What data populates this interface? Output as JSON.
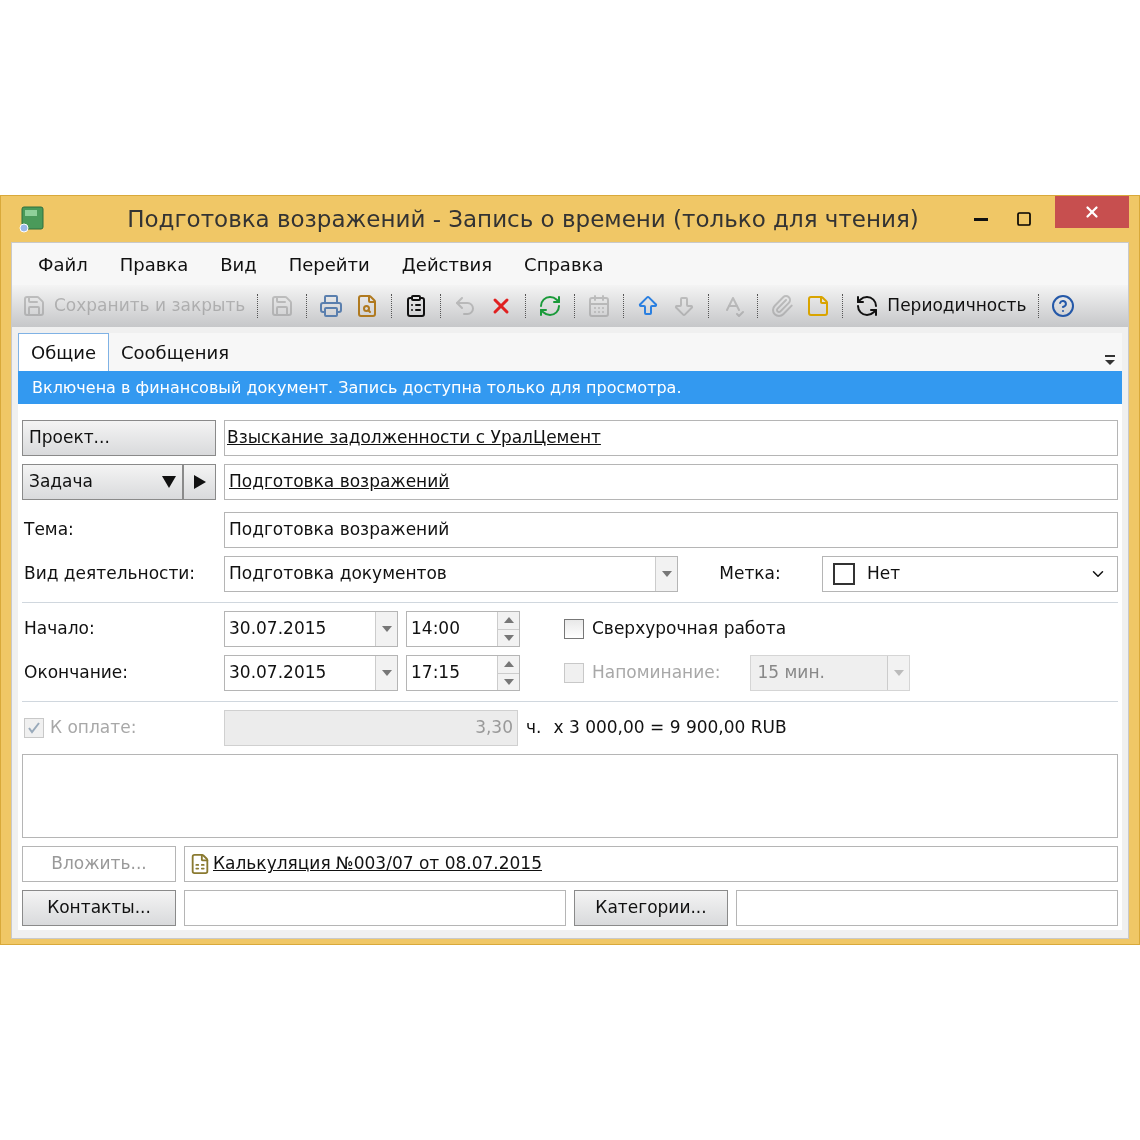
{
  "window": {
    "title": "Подготовка возражений - Запись о времени (только для чтения)"
  },
  "menu": [
    "Файл",
    "Правка",
    "Вид",
    "Перейти",
    "Действия",
    "Справка"
  ],
  "toolbar": [
    {
      "kind": "save-close",
      "label": "Сохранить и закрыть",
      "disabled": true
    },
    {
      "kind": "separator"
    },
    {
      "kind": "save",
      "disabled": true
    },
    {
      "kind": "separator"
    },
    {
      "kind": "print",
      "disabled": false
    },
    {
      "kind": "preview",
      "disabled": false
    },
    {
      "kind": "separator"
    },
    {
      "kind": "properties",
      "disabled": false
    },
    {
      "kind": "separator"
    },
    {
      "kind": "undo",
      "disabled": true
    },
    {
      "kind": "delete",
      "disabled": false
    },
    {
      "kind": "separator"
    },
    {
      "kind": "refresh",
      "disabled": false
    },
    {
      "kind": "separator"
    },
    {
      "kind": "calendar",
      "disabled": true
    },
    {
      "kind": "separator"
    },
    {
      "kind": "up",
      "disabled": false
    },
    {
      "kind": "down",
      "disabled": true
    },
    {
      "kind": "separator"
    },
    {
      "kind": "spelling",
      "disabled": true
    },
    {
      "kind": "separator"
    },
    {
      "kind": "attach",
      "disabled": true
    },
    {
      "kind": "note",
      "disabled": false
    },
    {
      "kind": "separator"
    },
    {
      "kind": "recurrence",
      "label": "Периодичность",
      "disabled": false
    },
    {
      "kind": "separator"
    },
    {
      "kind": "help",
      "disabled": false
    }
  ],
  "tabs": [
    {
      "label": "Общие",
      "selected": true
    },
    {
      "label": "Сообщения",
      "selected": false
    }
  ],
  "info_bar": "Включена в финансовый документ. Запись доступна только для просмотра.",
  "project": {
    "button": "Проект...",
    "value": "Взыскание задолженности с УралЦемент"
  },
  "task": {
    "button": "Задача",
    "value": "Подготовка возражений"
  },
  "subject": {
    "label": "Тема:",
    "value": "Подготовка возражений"
  },
  "activity": {
    "label": "Вид деятельности:",
    "value": "Подготовка документов"
  },
  "tag": {
    "label": "Метка:",
    "value": "Нет"
  },
  "start": {
    "label": "Начало:",
    "date": "30.07.2015",
    "time": "14:00"
  },
  "end": {
    "label": "Окончание:",
    "date": "30.07.2015",
    "time": "17:15"
  },
  "overtime": {
    "label": "Сверхурочная работа",
    "checked": false,
    "disabled": false
  },
  "reminder": {
    "label": "Напоминание:",
    "checked": false,
    "disabled": true,
    "value": "15 мин."
  },
  "billable": {
    "label": "К оплате:",
    "checked": true,
    "disabled": true,
    "hours": "3,30",
    "unit": "ч.",
    "formula": "x 3 000,00 = 9 900,00 RUB"
  },
  "attach": {
    "button": "Вложить...",
    "disabled": true,
    "file": "Калькуляция №003/07 от 08.07.2015"
  },
  "contacts": {
    "button": "Контакты..."
  },
  "categories": {
    "button": "Категории..."
  }
}
